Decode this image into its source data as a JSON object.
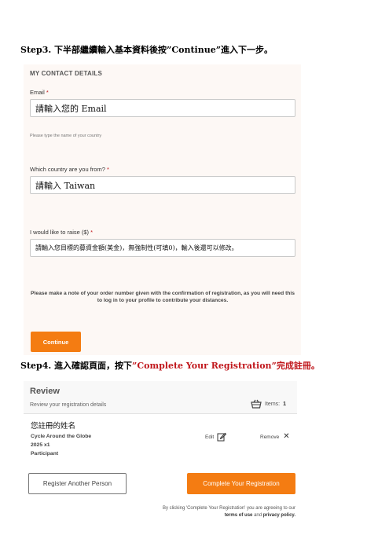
{
  "step3": {
    "prefix": "Step3.",
    "text_before": "下半部繼續輸入基本資料後按",
    "quoted": "”Continue”",
    "text_after": "進入下一步。"
  },
  "contact": {
    "section_title": "MY CONTACT DETAILS",
    "email_label": "Email",
    "email_required": "*",
    "email_value": "請輸入您的 Email",
    "country_hint": "Please type the name of your country",
    "country_label": "Which country are you from?",
    "country_required": "*",
    "country_value": "請輸入 Taiwan",
    "raise_label": "I would like to raise ($)",
    "raise_required": "*",
    "raise_value": "請輸入您目標的募資金額(美金)，無強制性(可填0)，輸入後還可以修改。",
    "note": "Please make a note of your order number given with the confirmation of registration, as you will need this to log in to your profile to contribute your distances.",
    "continue_label": "Continue"
  },
  "step4": {
    "prefix": "Step4.",
    "text_before": "進入確認頁面，按下",
    "quoted": "”Complete Your Registration”",
    "text_after": "完成註冊。",
    "accent_color": "#c0171c"
  },
  "review": {
    "title": "Review",
    "subtitle": "Review your registration details",
    "items_label": "Items:",
    "items_count": "1",
    "entry_name": "您註冊的姓名",
    "entry_event": "Cycle Around the Globe",
    "entry_qty": "2025 x1",
    "entry_type": "Participant",
    "edit_label": "Edit",
    "remove_label": "Remove",
    "icons": {
      "items": "basket-icon",
      "edit": "edit-icon",
      "remove": "close-icon"
    }
  },
  "actions": {
    "register_another": "Register Another Person",
    "complete": "Complete Your Registration",
    "brand_color": "#f47c12"
  },
  "terms": {
    "line1": "By clicking 'Complete Your Registration' you are agreeing to our",
    "terms_link": "terms of use",
    "and": "and",
    "privacy_link": "privacy policy."
  }
}
